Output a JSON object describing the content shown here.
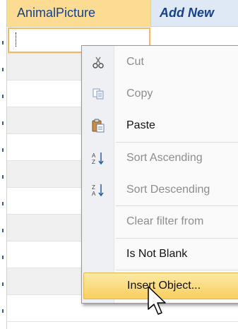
{
  "table": {
    "columns": [
      "AnimalPicture",
      "Add New"
    ]
  },
  "context_menu": {
    "items": [
      {
        "label": "Cut",
        "icon": "scissors-icon"
      },
      {
        "label": "Copy",
        "icon": "copy-icon"
      },
      {
        "label": "Paste",
        "icon": "paste-icon"
      },
      {
        "label": "Sort Ascending",
        "icon": "sort-ascending-icon"
      },
      {
        "label": "Sort Descending",
        "icon": "sort-descending-icon"
      },
      {
        "label": "Clear filter from",
        "icon": ""
      },
      {
        "label": "Is Not Blank",
        "icon": ""
      },
      {
        "label": "Insert Object...",
        "icon": ""
      }
    ]
  },
  "colors": {
    "header_selected": "#fbdc92",
    "header_normal": "#dfe8f5",
    "highlight": "#f8cf5e"
  }
}
